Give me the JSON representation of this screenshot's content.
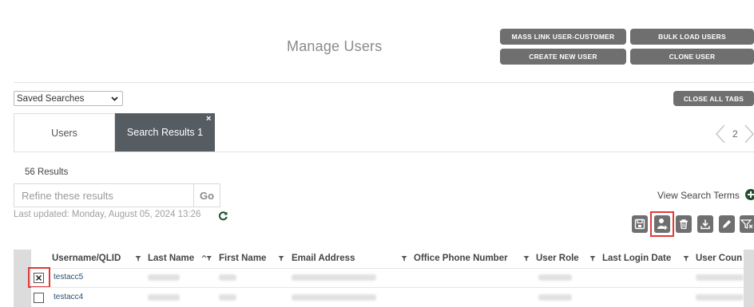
{
  "page": {
    "title": "Manage Users"
  },
  "actions": {
    "mass_link": "MASS LINK USER-CUSTOMER",
    "bulk_load": "BULK LOAD USERS",
    "create_user": "CREATE NEW USER",
    "clone_user": "CLONE USER",
    "close_all_tabs": "CLOSE ALL TABS"
  },
  "saved_searches": {
    "value": "Saved Searches"
  },
  "tabs": [
    {
      "label": "Users",
      "active": false
    },
    {
      "label": "Search Results 1",
      "active": true,
      "close": "×"
    }
  ],
  "pagination": {
    "page": "2"
  },
  "results": {
    "count": "56 Results",
    "refine_placeholder": "Refine these results",
    "go_label": "Go",
    "last_updated": "Last updated: Monday, August 05, 2024 13:26",
    "view_search_terms": "View Search Terms"
  },
  "toolbar_icons": [
    "save-icon",
    "add-user-icon",
    "trash-icon",
    "download-icon",
    "pencil-icon",
    "filter-icon"
  ],
  "table": {
    "columns": [
      "Username/QLID",
      "Last Name",
      "First Name",
      "Email Address",
      "Office Phone Number",
      "User Role",
      "Last Login Date",
      "User Coun"
    ],
    "rows": [
      {
        "username": "testacc5",
        "checked": true
      },
      {
        "username": "testacc4",
        "checked": false
      }
    ]
  },
  "colors": {
    "button_gray": "#6f6f6f",
    "active_tab": "#555d63",
    "highlight_red": "#e03a3a",
    "link_blue": "#2a4f74"
  }
}
